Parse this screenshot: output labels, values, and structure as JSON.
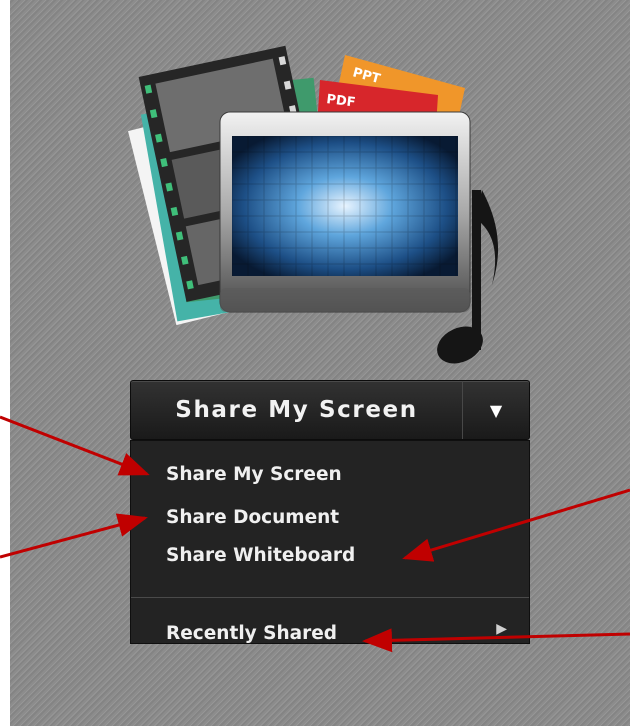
{
  "illustration": {
    "badges": [
      "PPT",
      "PDF"
    ],
    "colors": {
      "ppt_tab": "#f0962a",
      "pdf_tab": "#d7262b",
      "green_card": "#3f9a6c",
      "teal_card": "#45b3a8",
      "monitor_screen": "#3b85c5"
    }
  },
  "share_button": {
    "label": "Share My Screen",
    "arrow_icon": "caret-down-icon"
  },
  "menu": {
    "items": [
      {
        "label": "Share My Screen"
      },
      {
        "label": "Share Document"
      },
      {
        "label": "Share Whiteboard"
      }
    ],
    "recent": {
      "label": "Recently Shared",
      "submenu_icon": "chevron-right-icon"
    }
  },
  "annotations": {
    "arrow_color": "#c00000"
  }
}
